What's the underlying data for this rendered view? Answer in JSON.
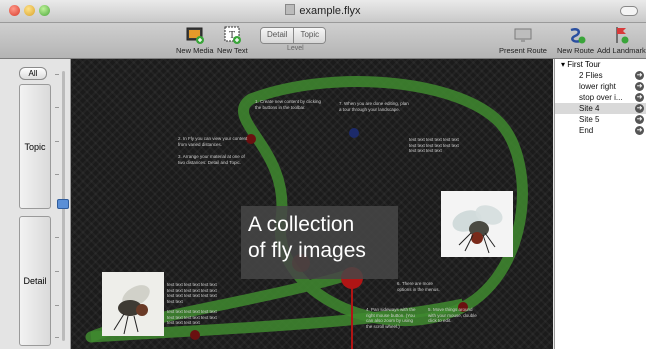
{
  "window": {
    "title": "example.flyx"
  },
  "toolbar": {
    "new_media": "New Media",
    "new_text": "New Text",
    "detail": "Detail",
    "topic": "Topic",
    "level": "Level",
    "present_route": "Present Route",
    "new_route": "New Route",
    "add_landmark": "Add Landmark"
  },
  "left_panel": {
    "all": "All",
    "topic": "Topic",
    "detail": "Detail"
  },
  "canvas": {
    "caption_line1": "A collection",
    "caption_line2": "of fly images",
    "notes": [
      "1. Create new content by clicking the buttons in the toolbar.",
      "7. When you are done editing, plan a tour through your landscape.",
      "2. In Fly you can view your content from varied distances.",
      "3. Arrange your material at one of two distances: Detail and Topic.",
      "text text text text text text text text text text text text text text text text",
      "6. There are more options in the menus.",
      "4. Pan sideways with the right mouse button. (You can also zoom by using the scroll wheel.)",
      "5. Move things around with your mouse, double click to edit.",
      "text text text text text text text text text text text text text text text text text text text text",
      "text text text text text text text text text text text text text text text text"
    ]
  },
  "tour": {
    "root": "First Tour",
    "items": [
      "2 Flies",
      "lower right",
      "stop over i...",
      "Site 4",
      "Site 5",
      "End"
    ],
    "selected_index": 3
  }
}
